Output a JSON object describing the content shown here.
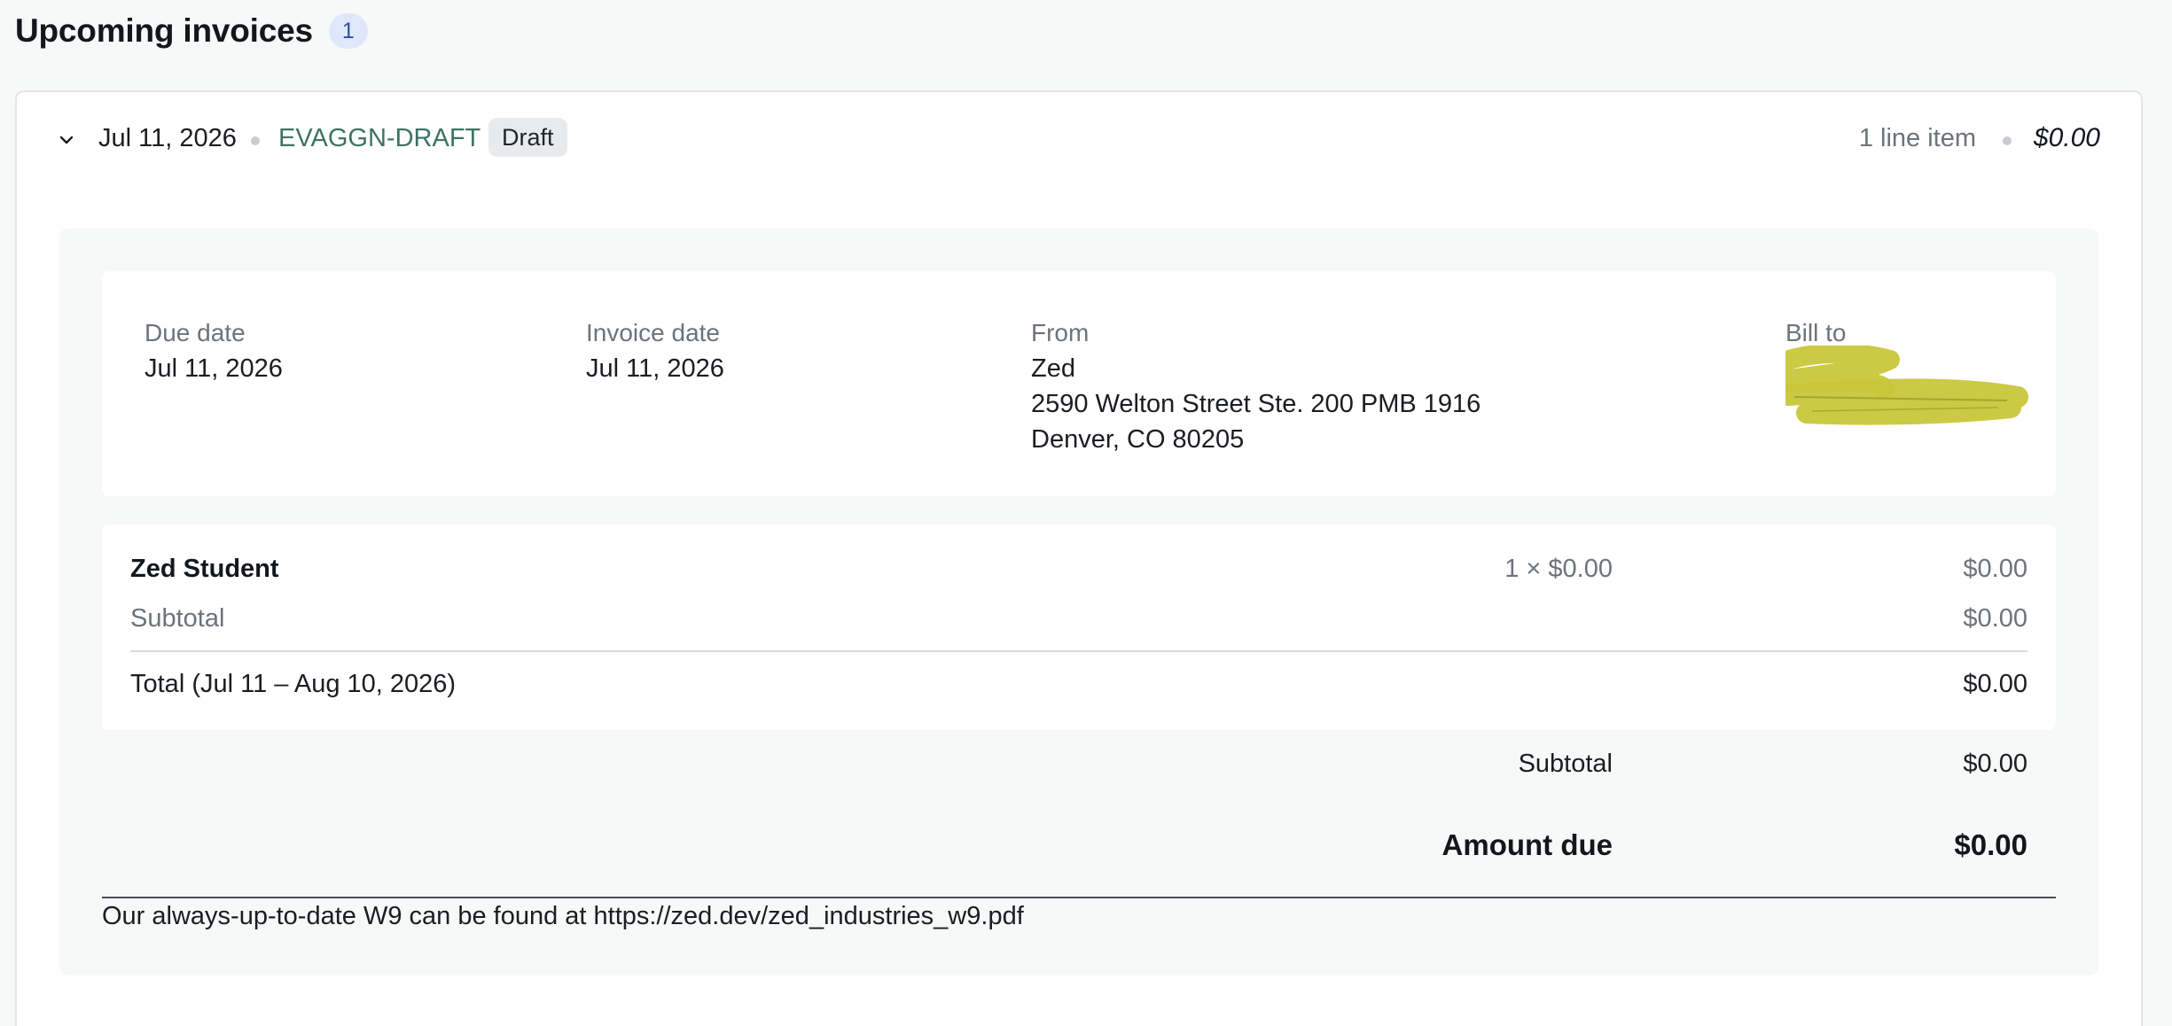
{
  "section": {
    "title": "Upcoming invoices",
    "count": "1"
  },
  "invoice": {
    "date": "Jul 11, 2026",
    "number": "EVAGGN-DRAFT",
    "status": "Draft",
    "line_items": "1 line item",
    "total": "$0.00",
    "details": {
      "due_label": "Due date",
      "due_value": "Jul 11, 2026",
      "invoice_date_label": "Invoice date",
      "invoice_date_value": "Jul 11, 2026",
      "from_label": "From",
      "from_name": "Zed",
      "from_address_1": "2590 Welton Street Ste. 200 PMB 1916",
      "from_address_2": "Denver, CO 80205",
      "bill_to_label": "Bill to"
    },
    "items": [
      {
        "name": "Zed Student",
        "qty_price": "1 × $0.00",
        "amount": "$0.00"
      }
    ],
    "items_subtotal_label": "Subtotal",
    "items_subtotal_value": "$0.00",
    "period_total_label": "Total (Jul 11 – Aug 10, 2026)",
    "period_total_value": "$0.00",
    "summary_subtotal_label": "Subtotal",
    "summary_subtotal_value": "$0.00",
    "amount_due_label": "Amount due",
    "amount_due_value": "$0.00",
    "footer_note": "Our always-up-to-date W9 can be found at https://zed.dev/zed_industries_w9.pdf"
  },
  "colors": {
    "link": "#3d7364",
    "redaction": "#c9c63a"
  },
  "icons": {
    "toggle": "chevron-down-icon"
  }
}
